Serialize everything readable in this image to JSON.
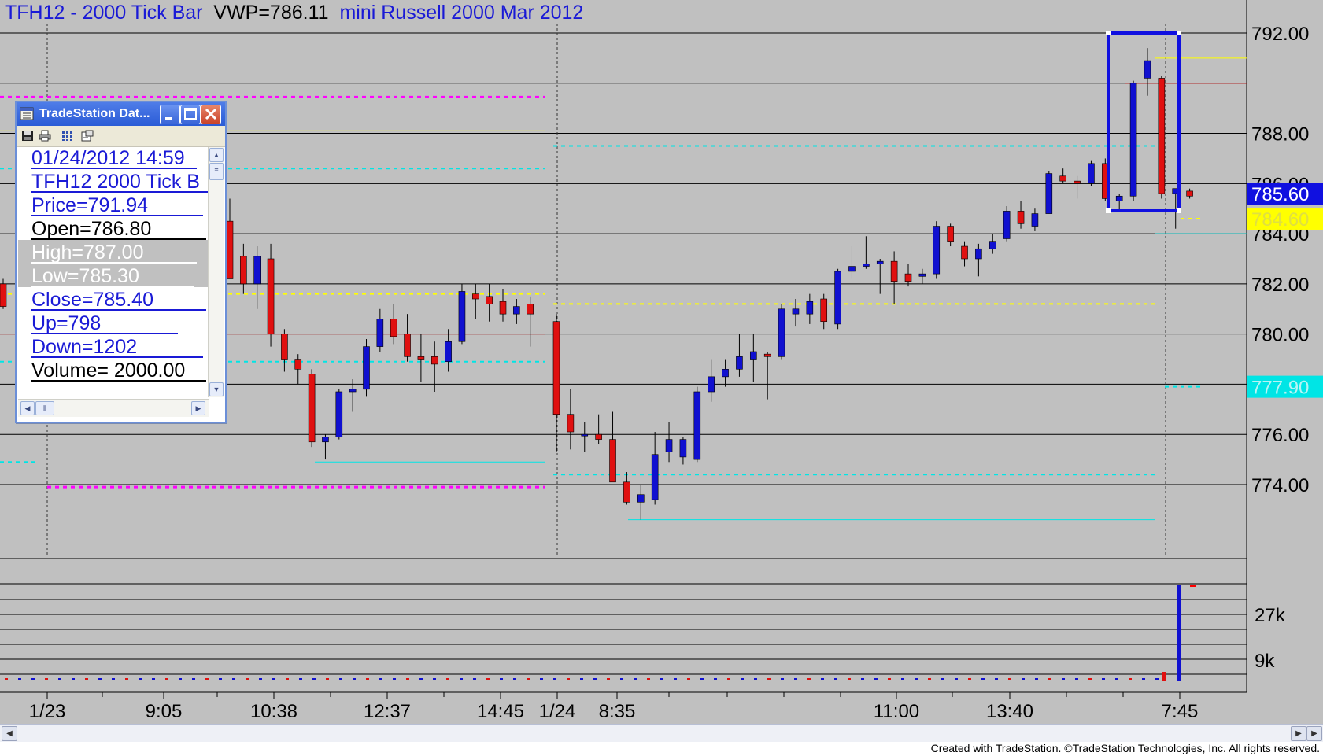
{
  "chart": {
    "symbol_title": "TFH12 - 2000 Tick Bar",
    "vwp_label": "VWP=786.11",
    "description": "mini Russell 2000 Mar 2012",
    "copyright": "Created with TradeStation. ©TradeStation Technologies, Inc. All rights reserved.",
    "colors": {
      "background": "#c0c0c0",
      "up_candle": "#1010d0",
      "down_candle": "#e01010",
      "magenta_level": "#ff00ff",
      "cyan_level": "#00e5e5",
      "yellow_level": "#ffff00",
      "red_level": "#ff0000"
    },
    "price_axis": {
      "labels": [
        "792.00",
        "788.00",
        "786.00",
        "784.00",
        "782.00",
        "780.00",
        "776.00",
        "774.00"
      ],
      "current_price_tag": "785.60",
      "yellow_tag": "784.60",
      "cyan_tag": "777.90"
    },
    "volume_axis": {
      "labels": [
        "27k",
        "9k"
      ]
    },
    "time_axis": {
      "labels": [
        "1/23",
        "9:05",
        "10:38",
        "12:37",
        "14:45",
        "1/24",
        "8:35",
        "11:00",
        "13:40",
        "7:45"
      ]
    }
  },
  "data_window": {
    "title": "TradeStation Dat...",
    "rows": [
      {
        "text": "01/24/2012 14:59"
      },
      {
        "text": "TFH12 2000 Tick B"
      },
      {
        "text": "Price=791.94"
      },
      {
        "text": "Open=786.80"
      },
      {
        "text": "High=787.00"
      },
      {
        "text": "Low=785.30"
      },
      {
        "text": "Close=785.40"
      },
      {
        "text": "Up=798"
      },
      {
        "text": "Down=1202"
      },
      {
        "text": "Volume= 2000.00"
      }
    ]
  },
  "chart_data": {
    "type": "candlestick",
    "title": "TFH12 - 2000 Tick Bar",
    "ylim": [
      772.4,
      792.3
    ],
    "candles": [
      {
        "o": 782.0,
        "h": 782.2,
        "l": 781.0,
        "c": 781.1
      },
      {
        "o": 784.5,
        "h": 785.4,
        "l": 782.5,
        "c": 782.2
      },
      {
        "o": 783.1,
        "h": 783.6,
        "l": 781.6,
        "c": 782.0
      },
      {
        "o": 782.0,
        "h": 783.5,
        "l": 781.0,
        "c": 783.1
      },
      {
        "o": 783.0,
        "h": 783.6,
        "l": 779.5,
        "c": 780.0
      },
      {
        "o": 780.0,
        "h": 780.2,
        "l": 778.5,
        "c": 779.0
      },
      {
        "o": 779.0,
        "h": 779.2,
        "l": 778.0,
        "c": 778.6
      },
      {
        "o": 778.4,
        "h": 778.6,
        "l": 775.5,
        "c": 775.7
      },
      {
        "o": 775.7,
        "h": 776.0,
        "l": 775.0,
        "c": 775.9
      },
      {
        "o": 775.9,
        "h": 777.8,
        "l": 775.8,
        "c": 777.7
      },
      {
        "o": 777.7,
        "h": 778.2,
        "l": 776.9,
        "c": 777.8
      },
      {
        "o": 777.8,
        "h": 779.8,
        "l": 777.5,
        "c": 779.5
      },
      {
        "o": 779.5,
        "h": 781.0,
        "l": 779.3,
        "c": 780.6
      },
      {
        "o": 780.6,
        "h": 781.2,
        "l": 779.6,
        "c": 779.9
      },
      {
        "o": 780.0,
        "h": 780.8,
        "l": 778.9,
        "c": 779.1
      },
      {
        "o": 779.1,
        "h": 780.0,
        "l": 778.1,
        "c": 779.0
      },
      {
        "o": 779.1,
        "h": 779.7,
        "l": 777.7,
        "c": 778.8
      },
      {
        "o": 778.9,
        "h": 780.2,
        "l": 778.5,
        "c": 779.7
      },
      {
        "o": 779.7,
        "h": 782.0,
        "l": 779.6,
        "c": 781.7
      },
      {
        "o": 781.6,
        "h": 782.0,
        "l": 780.6,
        "c": 781.4
      },
      {
        "o": 781.5,
        "h": 782.0,
        "l": 780.5,
        "c": 781.2
      },
      {
        "o": 781.3,
        "h": 781.8,
        "l": 780.5,
        "c": 780.8
      },
      {
        "o": 780.8,
        "h": 781.4,
        "l": 780.4,
        "c": 781.1
      },
      {
        "o": 781.2,
        "h": 781.5,
        "l": 779.5,
        "c": 780.8
      },
      {
        "o": 780.5,
        "h": 780.8,
        "l": 775.3,
        "c": 776.8
      },
      {
        "o": 776.8,
        "h": 777.8,
        "l": 775.4,
        "c": 776.1
      },
      {
        "o": 776.0,
        "h": 776.5,
        "l": 775.3,
        "c": 776.0
      },
      {
        "o": 776.0,
        "h": 776.8,
        "l": 775.6,
        "c": 775.8
      },
      {
        "o": 775.8,
        "h": 776.9,
        "l": 774.1,
        "c": 774.1
      },
      {
        "o": 774.1,
        "h": 774.5,
        "l": 773.2,
        "c": 773.3
      },
      {
        "o": 773.3,
        "h": 774.0,
        "l": 772.6,
        "c": 773.6
      },
      {
        "o": 773.4,
        "h": 776.1,
        "l": 773.2,
        "c": 775.2
      },
      {
        "o": 775.3,
        "h": 776.5,
        "l": 774.9,
        "c": 775.8
      },
      {
        "o": 775.1,
        "h": 775.9,
        "l": 774.8,
        "c": 775.8
      },
      {
        "o": 775.0,
        "h": 777.9,
        "l": 774.9,
        "c": 777.7
      },
      {
        "o": 777.7,
        "h": 779.0,
        "l": 777.3,
        "c": 778.3
      },
      {
        "o": 778.3,
        "h": 779.0,
        "l": 777.9,
        "c": 778.6
      },
      {
        "o": 778.6,
        "h": 780.0,
        "l": 778.3,
        "c": 779.1
      },
      {
        "o": 779.0,
        "h": 780.0,
        "l": 778.1,
        "c": 779.3
      },
      {
        "o": 779.2,
        "h": 779.3,
        "l": 777.4,
        "c": 779.1
      },
      {
        "o": 779.1,
        "h": 781.2,
        "l": 779.0,
        "c": 781.0
      },
      {
        "o": 780.8,
        "h": 781.4,
        "l": 780.3,
        "c": 781.0
      },
      {
        "o": 780.8,
        "h": 781.6,
        "l": 780.4,
        "c": 781.3
      },
      {
        "o": 781.4,
        "h": 781.6,
        "l": 780.2,
        "c": 780.5
      },
      {
        "o": 780.4,
        "h": 782.6,
        "l": 780.2,
        "c": 782.5
      },
      {
        "o": 782.5,
        "h": 783.5,
        "l": 782.2,
        "c": 782.7
      },
      {
        "o": 782.7,
        "h": 783.9,
        "l": 782.6,
        "c": 782.8
      },
      {
        "o": 782.8,
        "h": 783.0,
        "l": 781.6,
        "c": 782.9
      },
      {
        "o": 782.9,
        "h": 783.3,
        "l": 781.2,
        "c": 782.1
      },
      {
        "o": 782.4,
        "h": 782.8,
        "l": 781.9,
        "c": 782.1
      },
      {
        "o": 782.3,
        "h": 782.6,
        "l": 782.0,
        "c": 782.4
      },
      {
        "o": 782.4,
        "h": 784.5,
        "l": 782.2,
        "c": 784.3
      },
      {
        "o": 784.3,
        "h": 784.4,
        "l": 783.5,
        "c": 783.7
      },
      {
        "o": 783.5,
        "h": 783.7,
        "l": 782.7,
        "c": 783.0
      },
      {
        "o": 783.0,
        "h": 783.6,
        "l": 782.3,
        "c": 783.4
      },
      {
        "o": 783.4,
        "h": 784.0,
        "l": 783.2,
        "c": 783.7
      },
      {
        "o": 783.8,
        "h": 785.1,
        "l": 783.7,
        "c": 784.9
      },
      {
        "o": 784.9,
        "h": 785.3,
        "l": 784.2,
        "c": 784.4
      },
      {
        "o": 784.3,
        "h": 785.0,
        "l": 784.1,
        "c": 784.8
      },
      {
        "o": 784.8,
        "h": 786.5,
        "l": 784.8,
        "c": 786.4
      },
      {
        "o": 786.3,
        "h": 786.6,
        "l": 786.0,
        "c": 786.1
      },
      {
        "o": 786.1,
        "h": 786.3,
        "l": 785.4,
        "c": 786.0
      },
      {
        "o": 786.0,
        "h": 786.9,
        "l": 785.9,
        "c": 786.8
      },
      {
        "o": 786.8,
        "h": 787.0,
        "l": 785.3,
        "c": 785.4
      },
      {
        "o": 785.3,
        "h": 785.6,
        "l": 784.9,
        "c": 785.5
      },
      {
        "o": 785.5,
        "h": 790.1,
        "l": 785.3,
        "c": 790.0
      },
      {
        "o": 790.2,
        "h": 791.4,
        "l": 789.5,
        "c": 790.9
      },
      {
        "o": 790.2,
        "h": 790.3,
        "l": 785.4,
        "c": 785.6
      },
      {
        "o": 785.6,
        "h": 785.8,
        "l": 784.2,
        "c": 785.8
      },
      {
        "o": 785.7,
        "h": 785.8,
        "l": 785.4,
        "c": 785.5
      }
    ]
  }
}
